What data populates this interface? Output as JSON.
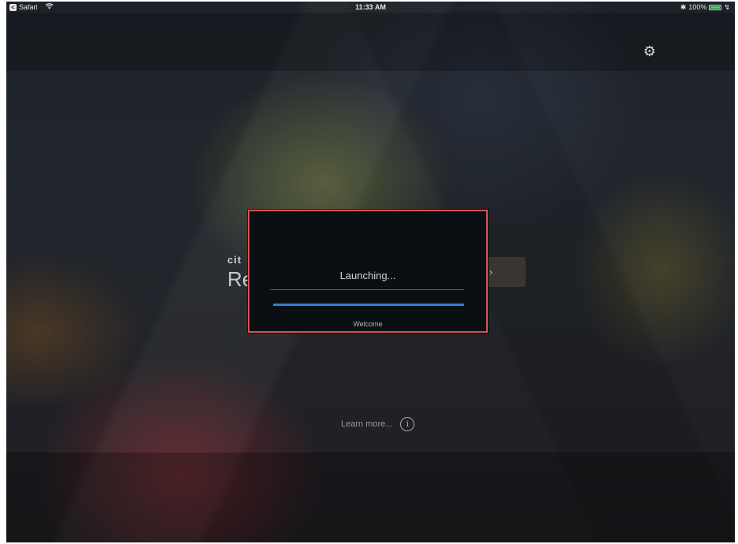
{
  "status_bar": {
    "back_app_label": "Safari",
    "time": "11:33 AM",
    "battery_percent": "100%",
    "battery_level": 1.0,
    "bluetooth_glyph": "✱",
    "icons": [
      "back-icon",
      "wifi-icon",
      "bluetooth-icon",
      "battery-icon"
    ]
  },
  "settings": {
    "icon": "gear-icon",
    "glyph": "⚙"
  },
  "background": {
    "brand_small": "cit",
    "brand_large": "Re",
    "button_fragment": "›"
  },
  "learn_more": {
    "label": "Learn more...",
    "icon_glyph": "i"
  },
  "dialog": {
    "title": "Launching...",
    "progress": 1.0,
    "status_text": "Welcome",
    "colors": {
      "border": "#d9534f",
      "progress": "#2d7fd1"
    }
  }
}
